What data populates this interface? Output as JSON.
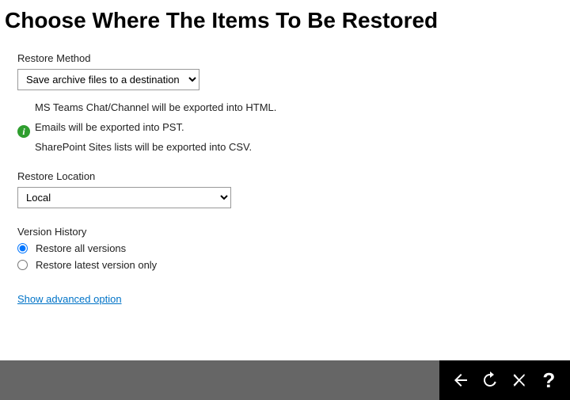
{
  "title": "Choose Where The Items To Be Restored",
  "restoreMethod": {
    "label": "Restore Method",
    "selected": "Save archive files to a destination",
    "options": [
      "Save archive files to a destination"
    ]
  },
  "infoLines": {
    "line1": "MS Teams Chat/Channel will be exported into HTML.",
    "line2": "Emails will be exported into PST.",
    "line3": "SharePoint Sites lists will be exported into CSV."
  },
  "restoreLocation": {
    "label": "Restore Location",
    "selected": "Local",
    "options": [
      "Local"
    ]
  },
  "versionHistory": {
    "label": "Version History",
    "optionAll": "Restore all versions",
    "optionLatest": "Restore latest version only",
    "selected": "all"
  },
  "advancedLink": "Show advanced option",
  "footer": {
    "back": "back",
    "retry": "retry",
    "cancel": "cancel",
    "help": "help"
  }
}
